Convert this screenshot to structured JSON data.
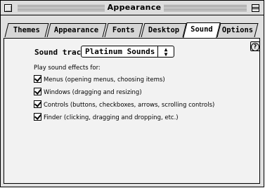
{
  "window": {
    "title": "Appearance"
  },
  "tabs": [
    {
      "label": "Themes",
      "active": false
    },
    {
      "label": "Appearance",
      "active": false
    },
    {
      "label": "Fonts",
      "active": false
    },
    {
      "label": "Desktop",
      "active": false
    },
    {
      "label": "Sound",
      "active": true
    },
    {
      "label": "Options",
      "active": false
    }
  ],
  "sound": {
    "soundtrack_label": "Sound track:",
    "soundtrack_value": "Platinum Sounds",
    "effects_label": "Play sound effects for:",
    "effects": [
      {
        "label": "Menus (opening menus, choosing items)",
        "checked": true
      },
      {
        "label": "Windows (dragging and resizing)",
        "checked": true
      },
      {
        "label": "Controls (buttons, checkboxes, arrows, scrolling controls)",
        "checked": true
      },
      {
        "label": "Finder (clicking, dragging and dropping, etc.)",
        "checked": true
      }
    ]
  },
  "help": {
    "glyph": "?"
  }
}
